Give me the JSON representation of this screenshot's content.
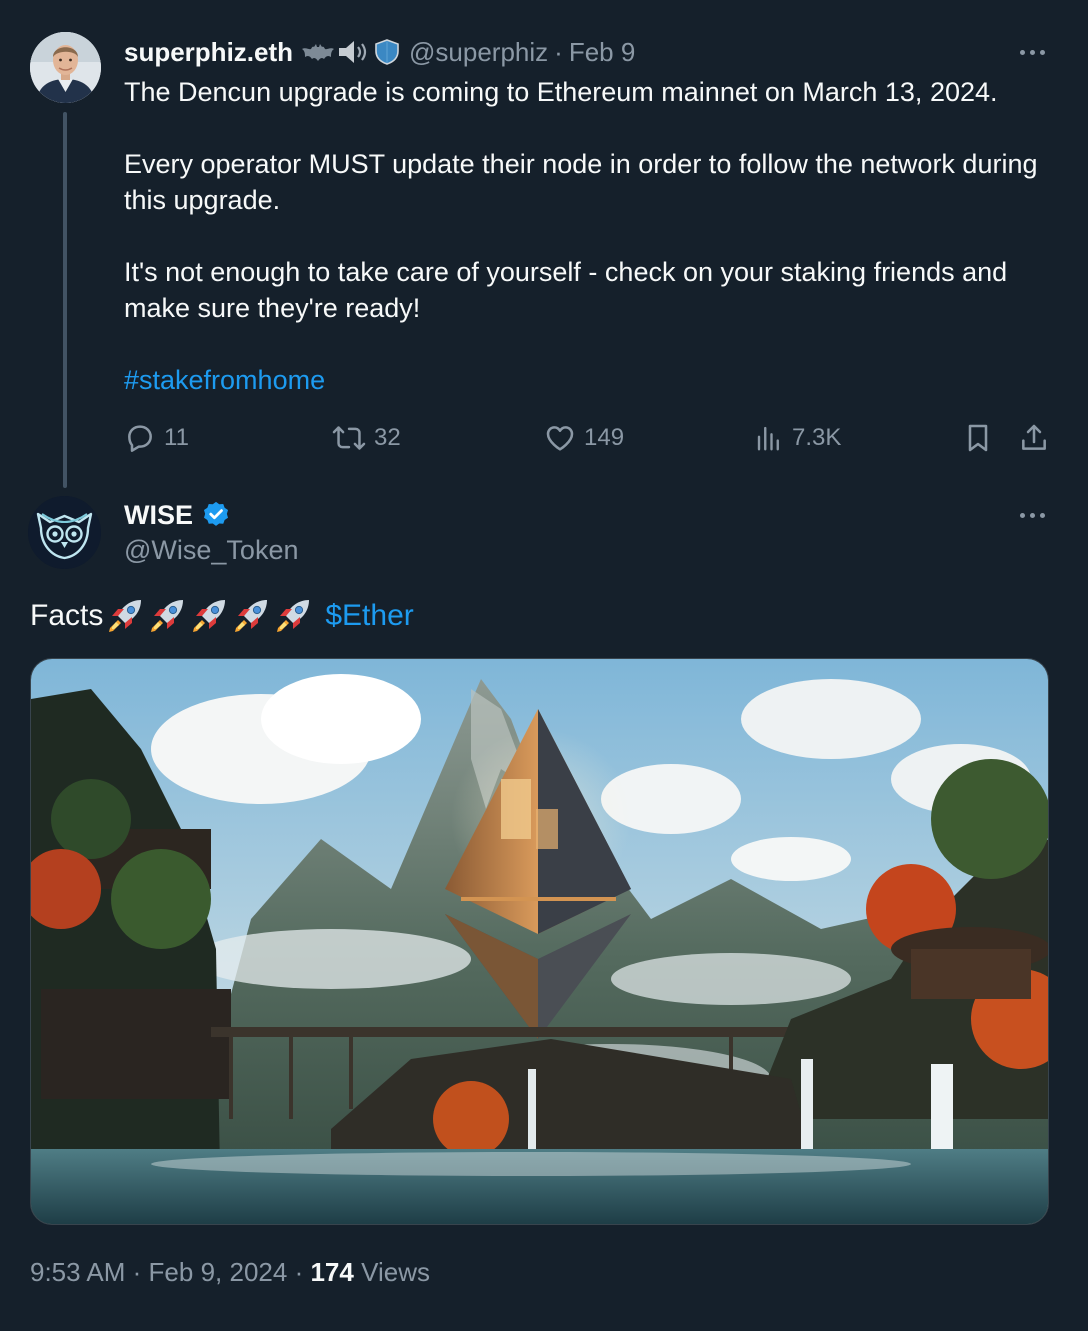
{
  "parent_tweet": {
    "author_name": "superphiz.eth",
    "handle": "@superphiz",
    "separator": "·",
    "date": "Feb 9",
    "badge_icons": [
      "bat-emoji-icon",
      "speaker-emoji-icon",
      "shield-emoji-icon"
    ],
    "paragraphs": [
      "The Dencun upgrade is coming to Ethereum mainnet on March 13, 2024.",
      "",
      "Every operator MUST update their node in order to follow the network during this upgrade.",
      "",
      "It's not enough to take care of yourself - check on your staking friends and make sure they're ready!",
      "",
      "#stakefromhome"
    ],
    "hashtag": "#stakefromhome",
    "actions": {
      "replies": "11",
      "retweets": "32",
      "likes": "149",
      "views": "7.3K"
    }
  },
  "reply_tweet": {
    "author_name": "WISE",
    "handle": "@Wise_Token",
    "text_prefix": "Facts",
    "rocket_count": 5,
    "cashtag": "$Ether",
    "verified": true,
    "timestamp": {
      "time": "9:53 AM",
      "separator1": "·",
      "date": "Feb 9, 2024",
      "separator2": "·",
      "views_count": "174",
      "views_label": "Views"
    }
  },
  "colors": {
    "background": "#15202b",
    "primary_text": "#f7f9f9",
    "secondary_text": "#8b98a5",
    "accent": "#1d9bf0",
    "thread_line": "#425364"
  }
}
